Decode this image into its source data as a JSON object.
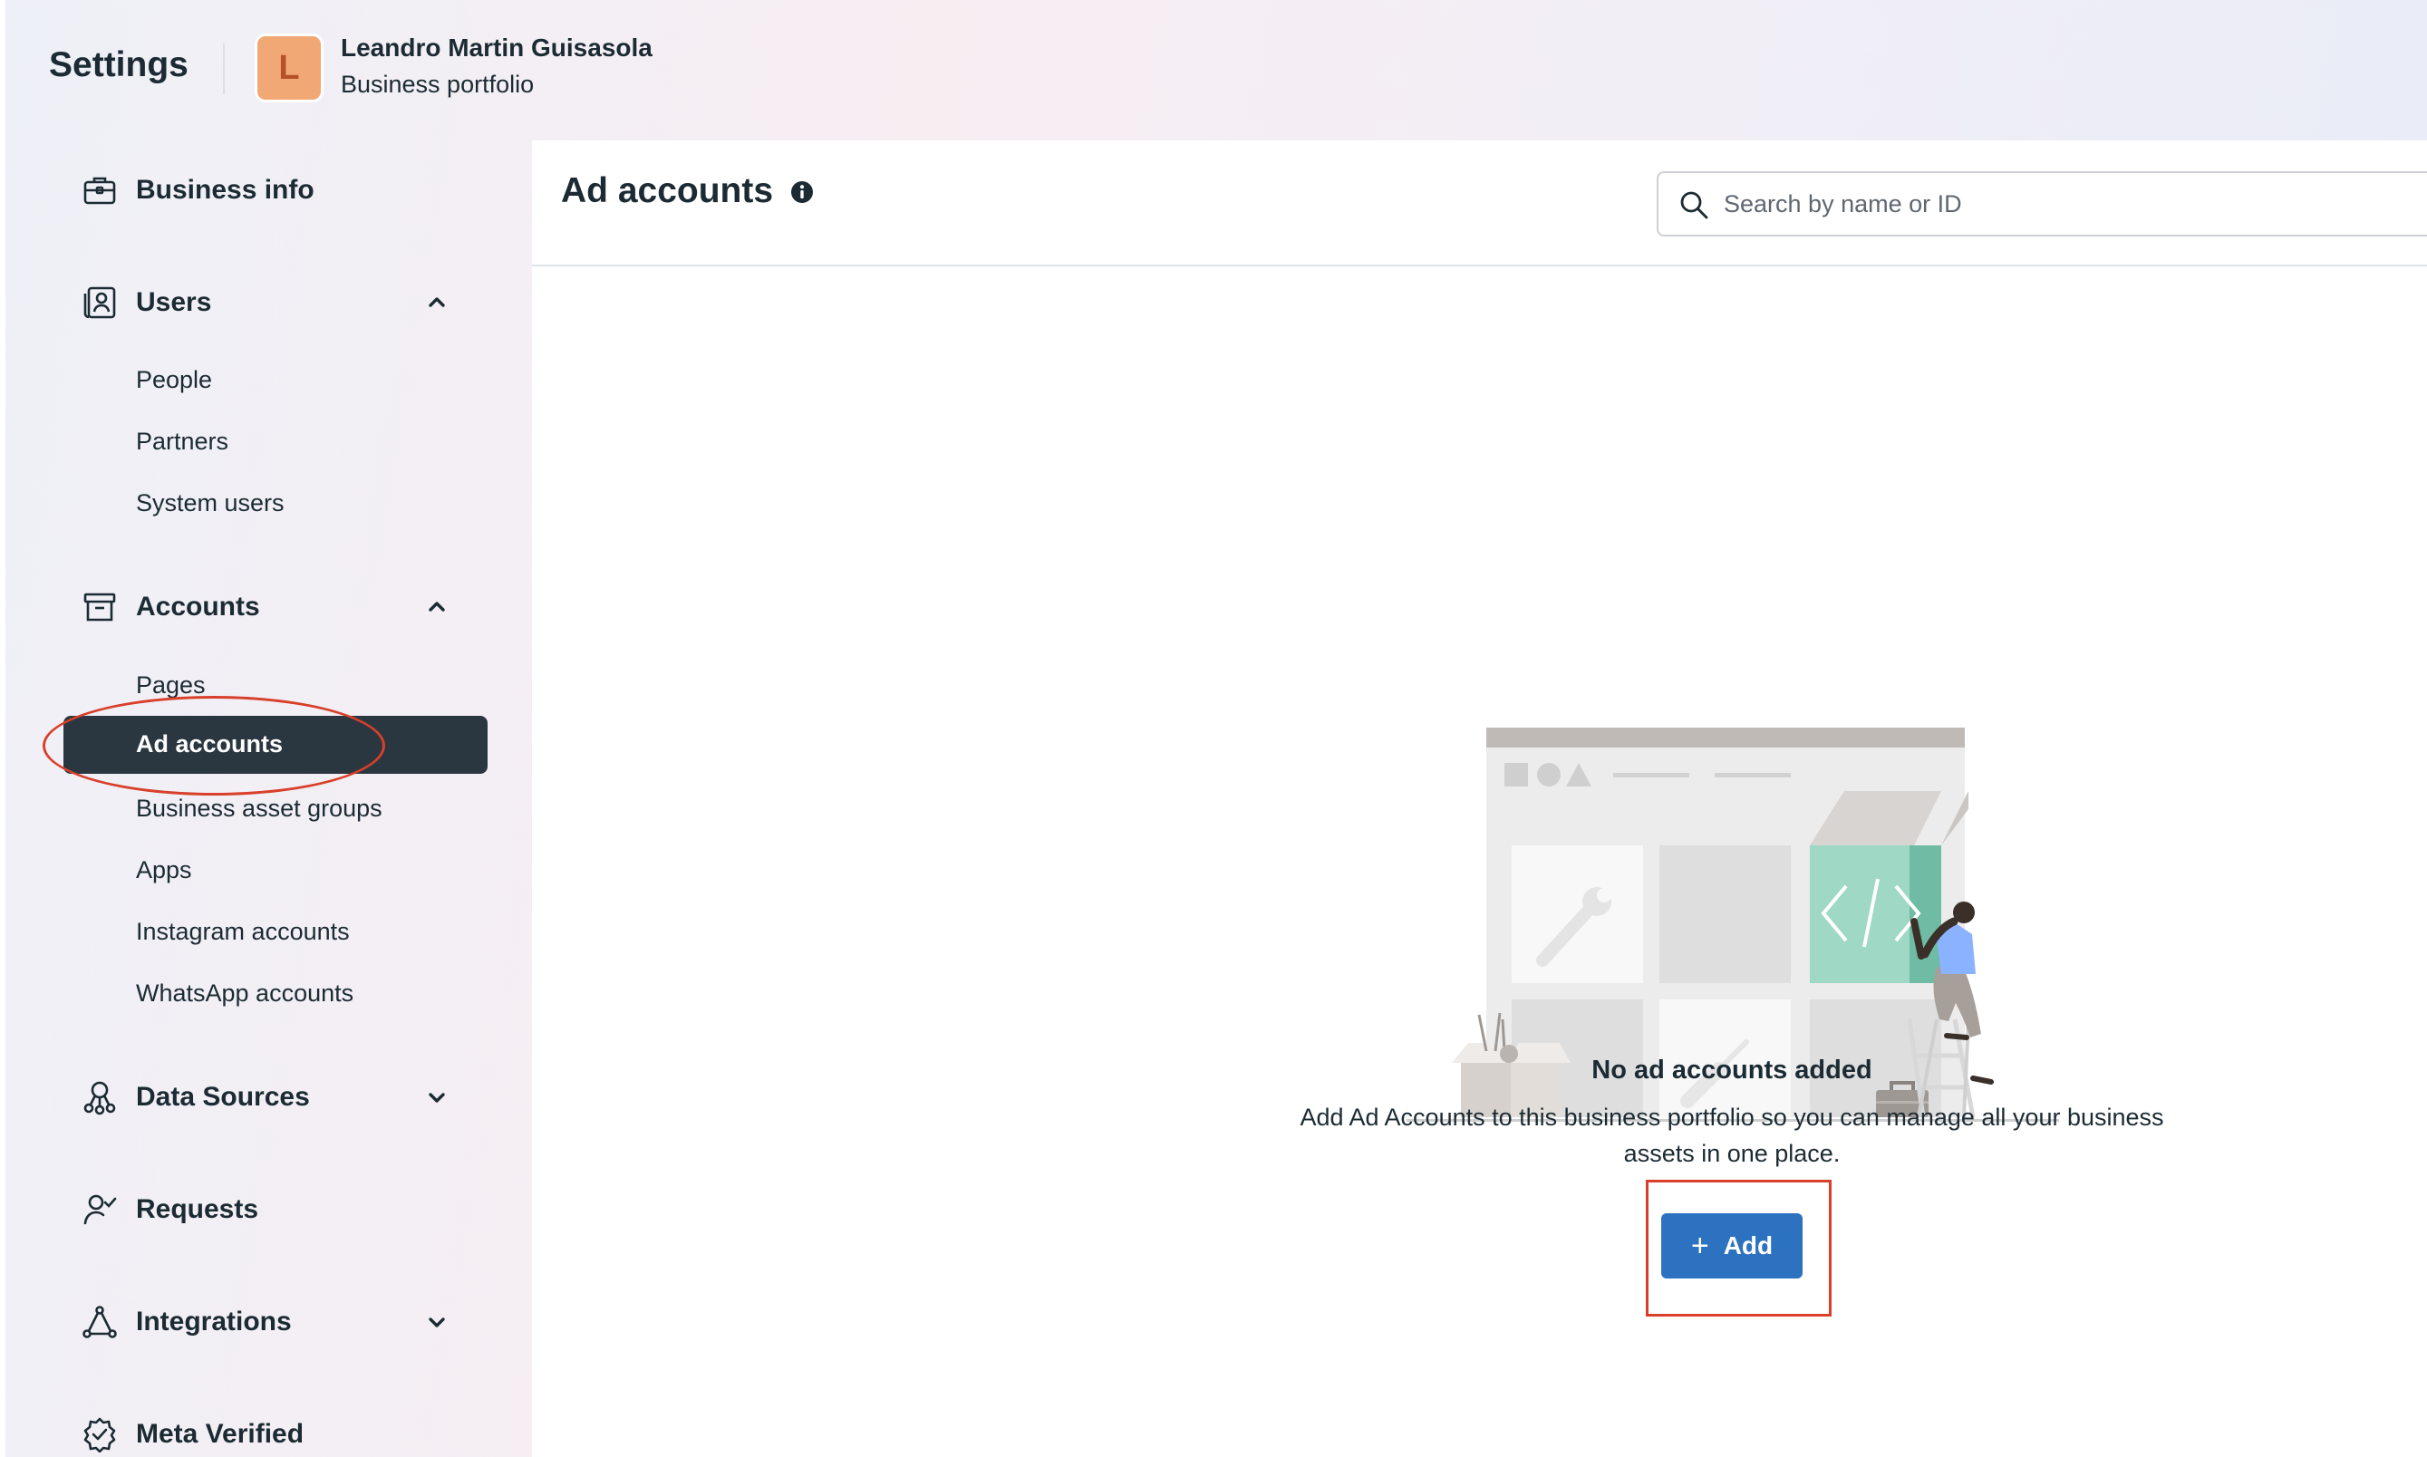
{
  "header": {
    "title": "Settings",
    "avatar_letter": "L",
    "account_name": "Leandro Martin Guisasola",
    "account_type": "Business portfolio"
  },
  "sidebar": {
    "business_info": "Business info",
    "users": {
      "label": "Users",
      "expanded": true,
      "items": [
        "People",
        "Partners",
        "System users"
      ]
    },
    "accounts": {
      "label": "Accounts",
      "expanded": true,
      "items": [
        "Pages",
        "Ad accounts",
        "Business asset groups",
        "Apps",
        "Instagram accounts",
        "WhatsApp accounts"
      ],
      "selected": "Ad accounts"
    },
    "data_sources": "Data Sources",
    "requests": "Requests",
    "integrations": "Integrations",
    "meta_verified": "Meta Verified"
  },
  "main": {
    "title": "Ad accounts",
    "search_placeholder": "Search by name or ID",
    "empty_title": "No ad accounts added",
    "empty_description": "Add Ad Accounts to this business portfolio so you can manage all your business assets in one place.",
    "add_label": "Add"
  },
  "colors": {
    "selected_bg": "#2b3740",
    "primary_button": "#2d72c0",
    "annotation": "#d9402b",
    "avatar": "#f2a875"
  }
}
